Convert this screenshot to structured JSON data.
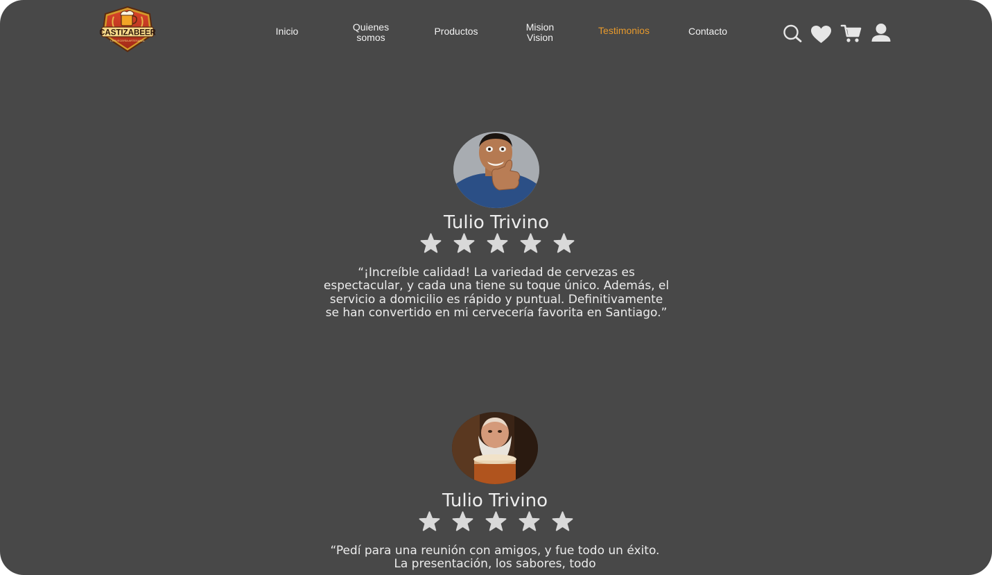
{
  "header": {
    "logo_text": "CASTIZABEER",
    "logo_subtext": "CERVECERÍA ARTESANAL",
    "nav": [
      {
        "label": "Inicio",
        "active": false
      },
      {
        "label": "Quienes\nsomos",
        "active": false
      },
      {
        "label": "Productos",
        "active": false
      },
      {
        "label": "Mision\nVision",
        "active": false
      },
      {
        "label": "Testimonios",
        "active": true
      },
      {
        "label": "Contacto",
        "active": false
      }
    ],
    "icons": [
      "search-icon",
      "heart-icon",
      "cart-icon",
      "user-icon"
    ]
  },
  "colors": {
    "background": "#484848",
    "accent": "#e89a2c",
    "star": "#d9d9d9",
    "text": "#ededed"
  },
  "testimonials": [
    {
      "name": "Tulio Trivino",
      "rating": 5,
      "quote": "“¡Increíble calidad! La variedad de cervezas es espectacular, y cada una tiene su toque único. Además, el servicio a domicilio es rápido y puntual. Definitivamente se han convertido en mi cervecería favorita en Santiago.”"
    },
    {
      "name": "Tulio Trivino",
      "rating": 5,
      "quote": "“Pedí para una reunión con amigos, y fue todo un éxito. La presentación, los sabores, todo"
    }
  ]
}
